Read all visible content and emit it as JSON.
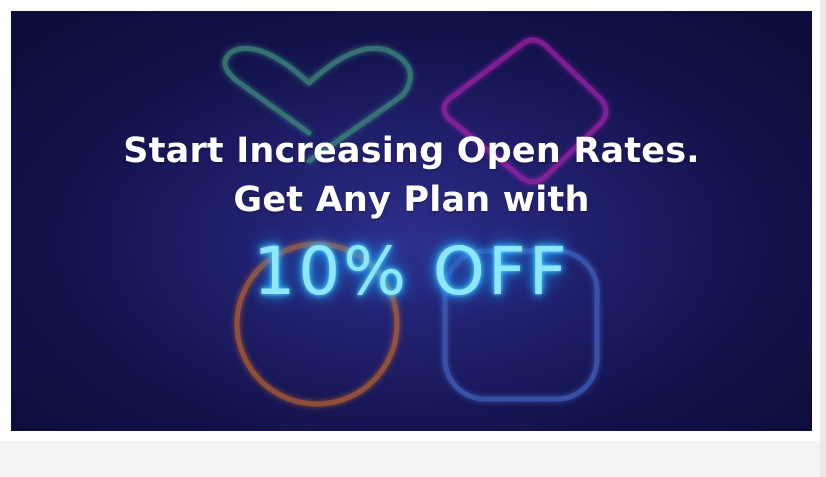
{
  "banner": {
    "headline_line1": "Start Increasing Open Rates.",
    "headline_line2": "Get Any Plan with",
    "offer": "10% OFF"
  },
  "colors": {
    "background_deep": "#0d0d3b",
    "background_glow": "#2e2f8c",
    "offer_neon": "#8fe6ff",
    "heart_neon": "#3f8f7f",
    "diamond_neon": "#a020a8",
    "circle_neon": "#c2662c",
    "square_neon": "#3c5fb8"
  },
  "icons": [
    "heart-icon",
    "diamond-icon",
    "circle-icon",
    "rounded-square-icon"
  ]
}
